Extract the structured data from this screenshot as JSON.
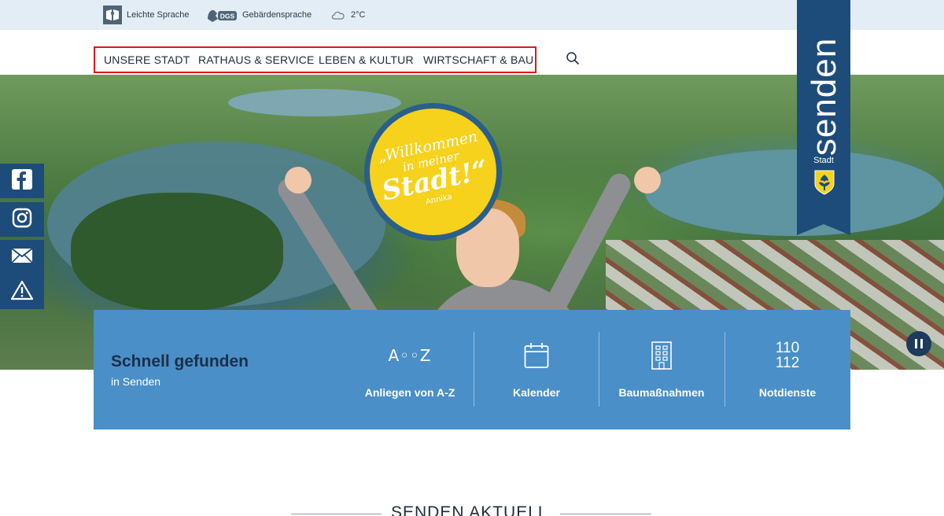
{
  "utility": {
    "easy_language": "Leichte Sprache",
    "sign_language_badge": "DGS",
    "sign_language": "Gebärdensprache",
    "weather_temp": "2°C",
    "weather_icon": "cloud-icon"
  },
  "nav": {
    "items": [
      {
        "label": "UNSERE STADT"
      },
      {
        "label": "RATHAUS & SERVICE"
      },
      {
        "label": "LEBEN & KULTUR"
      },
      {
        "label": "WIRTSCHAFT & BAU"
      }
    ],
    "search_icon": "search-icon",
    "highlight_color": "#e2161b"
  },
  "hero": {
    "badge_line1": "„Willkommen",
    "badge_line2": "in meiner",
    "badge_line3": "Stadt!“",
    "badge_signature": "Annika",
    "badge_color": "#f6d21d"
  },
  "logo": {
    "name": "senden",
    "subtitle": "Stadt",
    "brand_color": "#1d4c7a"
  },
  "social": [
    "facebook-icon",
    "instagram-icon",
    "mail-icon",
    "warning-icon"
  ],
  "quick": {
    "title": "Schnell gefunden",
    "subtitle": "in Senden",
    "panel_color": "#4a8fc8",
    "items": [
      {
        "label": "Anliegen von A-Z",
        "icon_text": "A◦◦Z"
      },
      {
        "label": "Kalender"
      },
      {
        "label": "Baumaßnahmen"
      },
      {
        "label": "Notdienste",
        "icon_line1": "110",
        "icon_line2": "112"
      }
    ]
  },
  "news": {
    "title": "SENDEN AKTUELL"
  }
}
